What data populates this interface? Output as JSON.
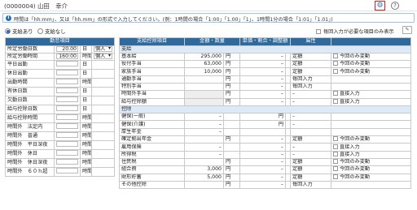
{
  "window_title": "(0000004) 山田　幸介",
  "notice": "時間は「hh:mm」、又は「hh.mm」の形式で入力してください。(例：1時間の場合「1:00」「1.00」「1」、1時間1分の場合「1:01」「1.01」)",
  "radio1": "支給あり",
  "radio2": "支給なし",
  "memo_check": "毎回入力が必要な項目のみ表示",
  "left": {
    "header": "勤怠項目",
    "rows": [
      {
        "label": "所定労働日数",
        "value": "20.00",
        "unit": "日",
        "select": "個人"
      },
      {
        "label": "所定労働時間",
        "value": "160:00",
        "unit": "時間",
        "select": "個人"
      },
      {
        "label": "平日出勤",
        "value": "",
        "unit": "日",
        "select": ""
      },
      {
        "label": "休日出勤",
        "value": "",
        "unit": "日",
        "select": ""
      },
      {
        "label": "出勤時間",
        "value": "",
        "unit": "時間",
        "select": ""
      },
      {
        "label": "有休日数",
        "value": "",
        "unit": "日",
        "select": ""
      },
      {
        "label": "欠勤日数",
        "value": "",
        "unit": "日",
        "select": ""
      },
      {
        "label": "給与控除日数",
        "value": "",
        "unit": "日",
        "select": ""
      },
      {
        "label": "給与控除時間",
        "value": "",
        "unit": "時間",
        "select": ""
      },
      {
        "label": "時間外　法定内",
        "value": "",
        "unit": "時間",
        "select": ""
      },
      {
        "label": "時間外　普通",
        "value": "",
        "unit": "時間",
        "select": ""
      },
      {
        "label": "時間外　平日深夜",
        "value": "",
        "unit": "時間",
        "select": ""
      },
      {
        "label": "時間外　休日",
        "value": "",
        "unit": "時間",
        "select": ""
      },
      {
        "label": "時間外　休日深夜",
        "value": "",
        "unit": "時間",
        "select": ""
      },
      {
        "label": "時間外　６０ｈ超",
        "value": "",
        "unit": "時間",
        "select": ""
      }
    ]
  },
  "right": {
    "headers": [
      "支給控除項目",
      "金額・数量",
      "単価・割合・調整額",
      "属性",
      ""
    ],
    "sec1": "支給",
    "sec2": "控除",
    "rows1": [
      {
        "label": "基本給",
        "amount": "295,000",
        "unit": "円",
        "rate": "–",
        "attr": "定額",
        "opt": "今回のみ変動"
      },
      {
        "label": "役付手当",
        "amount": "63,000",
        "unit": "円",
        "rate": "–",
        "attr": "定額",
        "opt": "今回のみ変動"
      },
      {
        "label": "家族手当",
        "amount": "10,000",
        "unit": "円",
        "rate": "–",
        "attr": "定額",
        "opt": "今回のみ変動"
      },
      {
        "label": "通勤手当",
        "amount": "",
        "unit": "円",
        "rate": "–",
        "attr": "毎回入力",
        "opt": ""
      },
      {
        "label": "特別手当",
        "amount": "",
        "unit": "円",
        "rate": "–",
        "attr": "毎回入力",
        "opt": ""
      },
      {
        "label": "時間外手当",
        "amount": "",
        "unit": "円",
        "rate": "–",
        "attr": "–",
        "opt": "直接入力"
      },
      {
        "label": "給与控除額",
        "amount": "",
        "unit": "円",
        "rate": "–",
        "attr": "–",
        "opt": "直接入力"
      }
    ],
    "rows2": [
      {
        "label": "健保(一般)",
        "amount": "–",
        "unit": "",
        "rate": "円",
        "attr": "–",
        "opt": ""
      },
      {
        "label": "健保(介護)",
        "amount": "–",
        "unit": "",
        "rate": "円",
        "attr": "–",
        "opt": ""
      },
      {
        "label": "厚生年金",
        "amount": "–",
        "unit": "",
        "rate": "",
        "attr": "",
        "opt": ""
      },
      {
        "label": "確定拠出年金",
        "amount": "",
        "unit": "円",
        "rate": "–",
        "attr": "定額",
        "opt": "今回のみ変動"
      },
      {
        "label": "雇用保険",
        "amount": "–",
        "unit": "",
        "rate": "–",
        "attr": "–",
        "opt": "直接入力"
      },
      {
        "label": "所得税",
        "amount": "–",
        "unit": "",
        "rate": "–",
        "attr": "–",
        "opt": "直接入力"
      },
      {
        "label": "住民税",
        "amount": "",
        "unit": "円",
        "rate": "–",
        "attr": "定額",
        "opt": "今回のみ変動"
      },
      {
        "label": "組合費",
        "amount": "3,000",
        "unit": "円",
        "rate": "–",
        "attr": "定額",
        "opt": "今回のみ変動"
      },
      {
        "label": "財形貯蓄",
        "amount": "5,000",
        "unit": "円",
        "rate": "–",
        "attr": "定額",
        "opt": "今回のみ変動"
      },
      {
        "label": "その他控除",
        "amount": "",
        "unit": "円",
        "rate": "–",
        "attr": "毎回入力",
        "opt": ""
      }
    ]
  }
}
